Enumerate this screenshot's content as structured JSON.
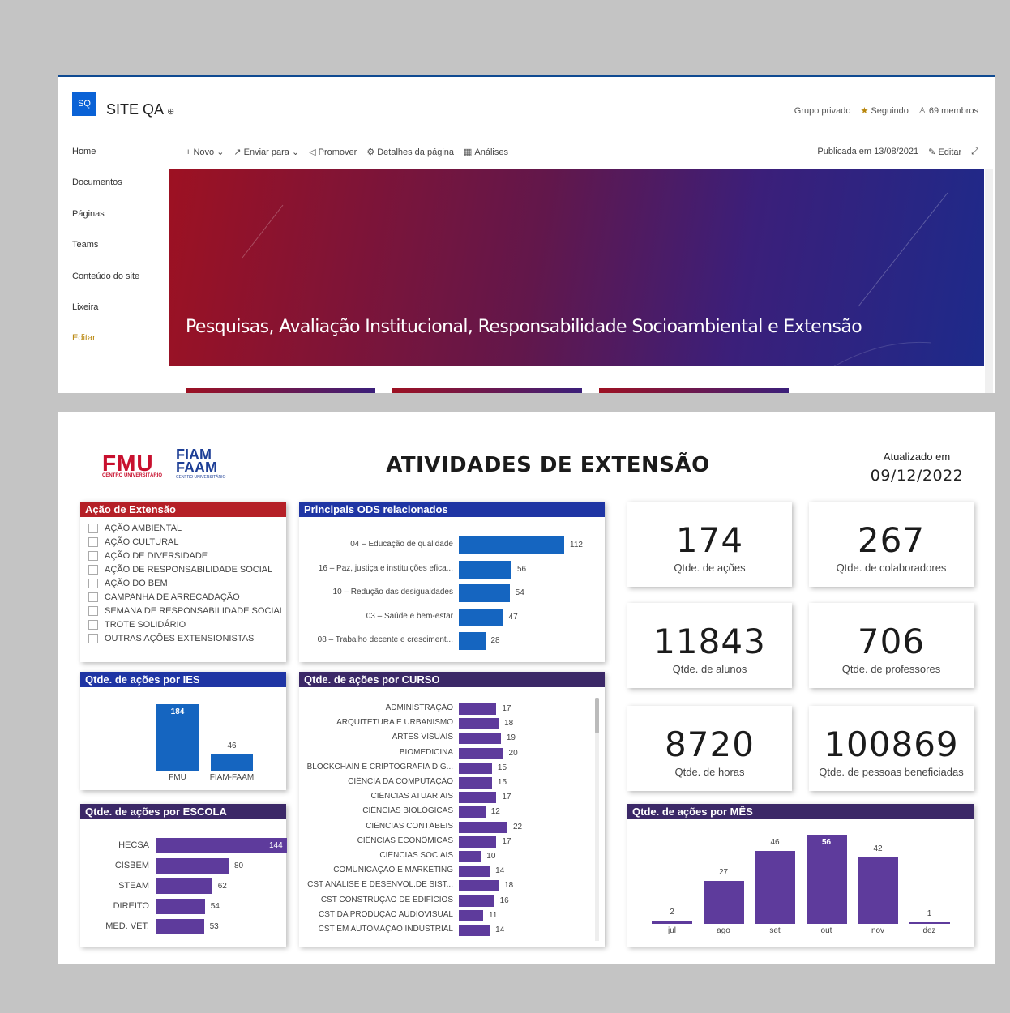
{
  "sharepoint": {
    "logo_initials": "SQ",
    "site_name": "SITE QA",
    "group_label": "Grupo privado",
    "following_label": "Seguindo",
    "members_label": "69 membros",
    "nav": [
      "Home",
      "Documentos",
      "Páginas",
      "Teams",
      "Conteúdo do site",
      "Lixeira",
      "Editar"
    ],
    "commands": [
      "Novo",
      "Enviar para",
      "Promover",
      "Detalhes da página",
      "Análises"
    ],
    "published": "Publicada em 13/08/2021",
    "edit_label": "Editar",
    "hero_title": "Pesquisas, Avaliação Institucional, Responsabilidade Socioambiental e Extensão"
  },
  "dashboard": {
    "logo_fmu": "FMU",
    "logo_fmu_sub": "CENTRO UNIVERSITÁRIO",
    "logo_fiam_line1": "FIAM",
    "logo_fiam_line2": "FAAM",
    "logo_fiam_sub": "CENTRO UNIVERSITÁRIO",
    "title": "ATIVIDADES DE EXTENSÃO",
    "updated_label": "Atualizado em",
    "updated_date": "09/12/2022",
    "slicer": {
      "title": "Ação de Extensão",
      "items": [
        "AÇÃO AMBIENTAL",
        "AÇÃO CULTURAL",
        "AÇÃO DE DIVERSIDADE",
        "AÇÃO DE RESPONSABILIDADE SOCIAL",
        "AÇÃO DO BEM",
        "CAMPANHA DE ARRECADAÇÃO",
        "SEMANA DE RESPONSABILIDADE SOCIAL",
        "TROTE SOLIDÁRIO",
        "OUTRAS AÇÕES EXTENSIONISTAS"
      ]
    },
    "kpis": [
      {
        "value": "174",
        "label": "Qtde. de ações"
      },
      {
        "value": "267",
        "label": "Qtde. de colaboradores"
      },
      {
        "value": "11843",
        "label": "Qtde. de alunos"
      },
      {
        "value": "706",
        "label": "Qtde. de professores"
      },
      {
        "value": "8720",
        "label": "Qtde. de horas"
      },
      {
        "value": "100869",
        "label": "Qtde. de pessoas beneficiadas"
      }
    ],
    "colors": {
      "red": "#b52027",
      "blue": "#1f35a4",
      "purple": "#3b2867",
      "bar_blue": "#1565c0",
      "bar_purple": "#5e3b9c"
    }
  },
  "chart_data": [
    {
      "type": "bar",
      "title": "Principais ODS relacionados",
      "orientation": "horizontal",
      "categories": [
        "04 – Educação de qualidade",
        "16 – Paz, justiça e instituições efica...",
        "10 – Redução das desigualdades",
        "03 – Saúde e bem-estar",
        "08 – Trabalho decente e cresciment..."
      ],
      "values": [
        112,
        56,
        54,
        47,
        28
      ]
    },
    {
      "type": "bar",
      "title": "Qtde. de ações por IES",
      "orientation": "vertical",
      "categories": [
        "FMU",
        "FIAM-FAAM"
      ],
      "values": [
        184,
        46
      ]
    },
    {
      "type": "bar",
      "title": "Qtde. de ações por ESCOLA",
      "orientation": "horizontal",
      "categories": [
        "HECSA",
        "CISBEM",
        "STEAM",
        "DIREITO",
        "MED. VET."
      ],
      "values": [
        144,
        80,
        62,
        54,
        53
      ]
    },
    {
      "type": "bar",
      "title": "Qtde. de ações por CURSO",
      "orientation": "horizontal",
      "categories": [
        "ADMINISTRAÇÃO",
        "ARQUITETURA E URBANISMO",
        "ARTES VISUAIS",
        "BIOMEDICINA",
        "BLOCKCHAIN E CRIPTOGRAFIA DIG...",
        "CIÊNCIA DA COMPUTAÇÃO",
        "CIÊNCIAS ATUARIAIS",
        "CIÊNCIAS BIOLÓGICAS",
        "CIÊNCIAS CONTÁBEIS",
        "CIÊNCIAS ECONÔMICAS",
        "CIÊNCIAS SOCIAIS",
        "COMUNICAÇÃO E MARKETING",
        "CST ANÁLISE E DESENVOL.DE SIST...",
        "CST CONSTRUÇÃO DE EDIFÍCIOS",
        "CST DA PRODUÇÃO AUDIOVISUAL",
        "CST EM AUTOMAÇÃO INDUSTRIAL"
      ],
      "values": [
        17,
        18,
        19,
        20,
        15,
        15,
        17,
        12,
        22,
        17,
        10,
        14,
        18,
        16,
        11,
        14
      ]
    },
    {
      "type": "bar",
      "title": "Qtde. de ações por MÊS",
      "orientation": "vertical",
      "categories": [
        "jul",
        "ago",
        "set",
        "out",
        "nov",
        "dez"
      ],
      "values": [
        2,
        27,
        46,
        56,
        42,
        1
      ]
    }
  ]
}
